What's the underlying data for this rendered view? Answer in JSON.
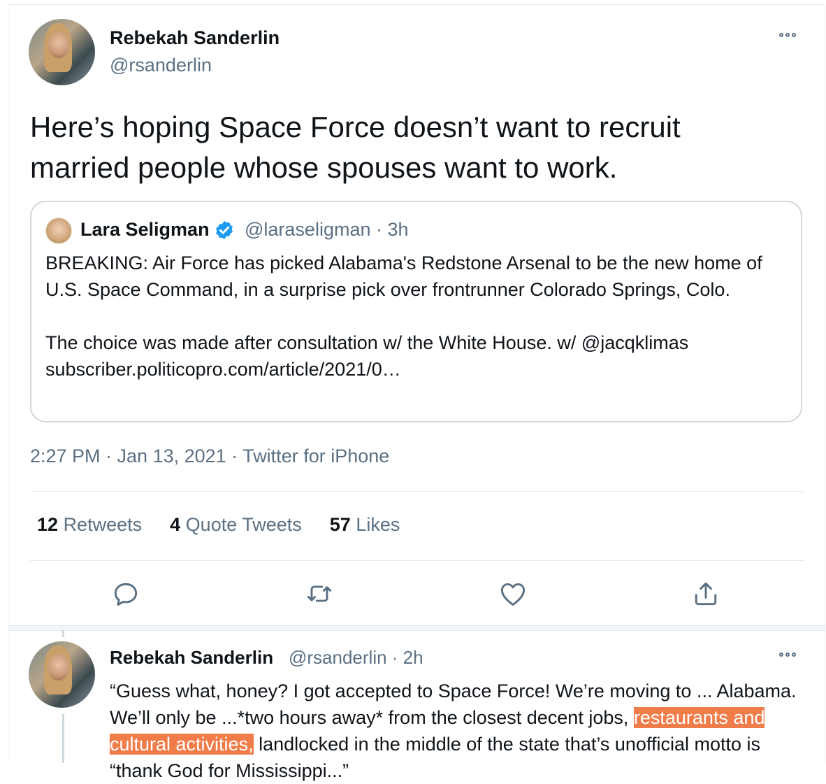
{
  "tweet": {
    "author_name": "Rebekah Sanderlin",
    "author_handle": "@rsanderlin",
    "text_line1": "Here’s hoping Space Force doesn’t want to recruit",
    "text_line2": "married people whose spouses want to work.",
    "quote": {
      "author_name": "Lara Seligman",
      "meta": "@laraseligman · 3h",
      "body": "BREAKING: Air Force has picked Alabama's Redstone Arsenal to be the new home of U.S. Space Command, in a surprise pick over frontrunner Colorado Springs, Colo.\n\nThe choice was made after consultation w/ the White House. w/ @jacqklimas\nsubscriber.politicopro.com/article/2021/0…"
    },
    "timestamp": "2:27 PM · Jan 13, 2021 · Twitter for iPhone",
    "stats": {
      "retweets_count": "12",
      "retweets_label": "Retweets",
      "quotes_count": "4",
      "quotes_label": "Quote Tweets",
      "likes_count": "57",
      "likes_label": "Likes"
    },
    "actions": [
      "reply-icon",
      "retweet-icon",
      "like-icon",
      "share-icon"
    ]
  },
  "reply": {
    "author_name": "Rebekah Sanderlin",
    "meta": "@rsanderlin · 2h",
    "text_part1": "“Guess what, honey? I got accepted to Space Force! We’re moving to ... Alabama. We’ll only be ...*two hours away* from the closest decent jobs, ",
    "text_highlight": "restaurants and cultural activities,",
    "text_part2": " landlocked in the middle of the state that’s unofficial motto is “thank God for Mississippi...”"
  },
  "colors": {
    "text": "#0f1419",
    "secondary": "#5b7083",
    "verified": "#1d9bf0",
    "highlight": "#f07c4a"
  }
}
